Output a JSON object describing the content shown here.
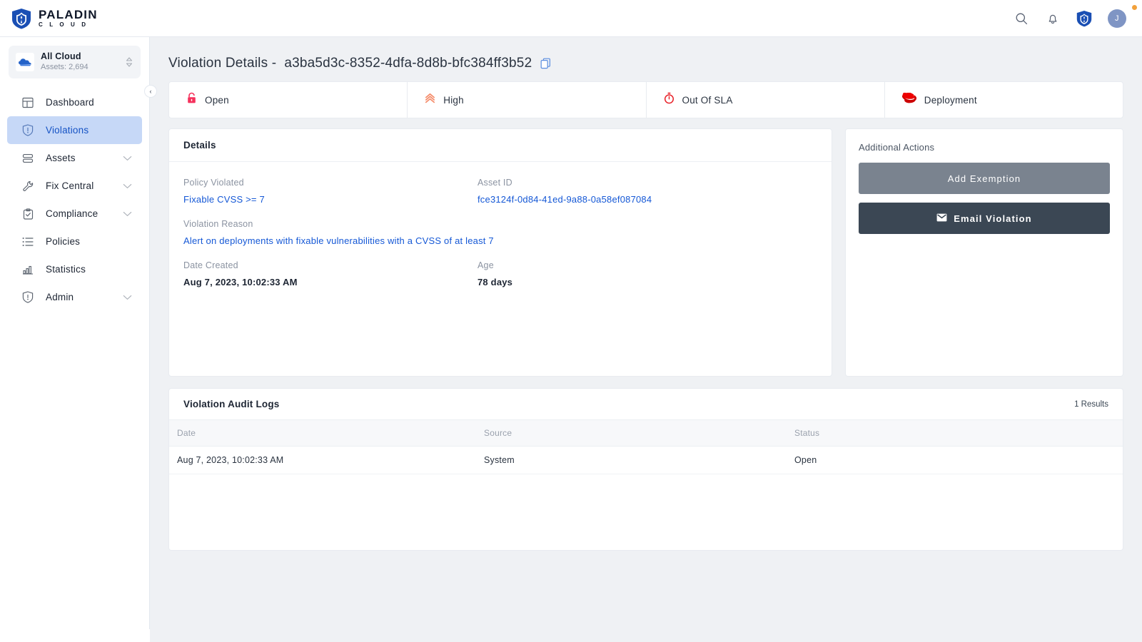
{
  "brand": {
    "name": "PALADIN",
    "sub": "C L O U D"
  },
  "topbar": {
    "icons": [
      {
        "name": "search-icon",
        "label": "Search"
      },
      {
        "name": "notifications-icon",
        "label": "Notifications"
      },
      {
        "name": "shield-logo-icon",
        "label": "Paladin Shield"
      }
    ],
    "avatar_initial": "J"
  },
  "sidebar": {
    "cloud_selector": {
      "name": "All Cloud",
      "assets": "Assets: 2,694"
    },
    "items": [
      {
        "label": "Dashboard",
        "icon": "dashboard-icon",
        "active": false,
        "caret": false
      },
      {
        "label": "Violations",
        "icon": "shield-alert-icon",
        "active": true,
        "caret": false
      },
      {
        "label": "Assets",
        "icon": "assets-icon",
        "active": false,
        "caret": true
      },
      {
        "label": "Fix Central",
        "icon": "wrench-icon",
        "active": false,
        "caret": true
      },
      {
        "label": "Compliance",
        "icon": "clipboard-check-icon",
        "active": false,
        "caret": true
      },
      {
        "label": "Policies",
        "icon": "list-icon",
        "active": false,
        "caret": false
      },
      {
        "label": "Statistics",
        "icon": "bar-chart-icon",
        "active": false,
        "caret": false
      },
      {
        "label": "Admin",
        "icon": "shield-icon",
        "active": false,
        "caret": true
      }
    ],
    "collapse_label": "‹"
  },
  "page": {
    "title_prefix": "Violation Details -",
    "violation_id": "a3ba5d3c-8352-4dfa-8d8b-bfc384ff3b52"
  },
  "status_bar": [
    {
      "label": "Open",
      "icon": "padlock-icon",
      "color": "#f5315c"
    },
    {
      "label": "High",
      "icon": "chevrons-up-icon",
      "color": "#f58b69"
    },
    {
      "label": "Out Of SLA",
      "icon": "stopwatch-icon",
      "color": "#e8232a"
    },
    {
      "label": "Deployment",
      "icon": "redhat-icon",
      "color": "#e2222b"
    }
  ],
  "details": {
    "card_title": "Details",
    "policy_violated_label": "Policy Violated",
    "policy_violated_value": "Fixable CVSS >= 7",
    "asset_id_label": "Asset ID",
    "asset_id_value": "fce3124f-0d84-41ed-9a88-0a58ef087084",
    "violation_reason_label": "Violation Reason",
    "violation_reason_value": "Alert on deployments with fixable vulnerabilities with a CVSS of at least 7",
    "date_created_label": "Date Created",
    "date_created_value": "Aug 7, 2023, 10:02:33 AM",
    "age_label": "Age",
    "age_value": "78 days"
  },
  "additional_actions": {
    "title": "Additional Actions",
    "add_exemption_label": "Add Exemption",
    "email_violation_label": "Email Violation"
  },
  "audit_logs": {
    "title": "Violation Audit Logs",
    "results": "1 Results",
    "columns": [
      "Date",
      "Source",
      "Status"
    ],
    "rows": [
      {
        "date": "Aug 7, 2023, 10:02:33 AM",
        "source": "System",
        "status": "Open"
      }
    ]
  },
  "colors": {
    "accent_blue": "#1558d6",
    "brand_navy": "#1a4fb4",
    "active_nav_bg": "#c6d8f7",
    "page_bg": "#eff1f4",
    "dark_button": "#3b4754",
    "grey_button": "#7a838f",
    "corner_dot": "#f2a13b"
  }
}
